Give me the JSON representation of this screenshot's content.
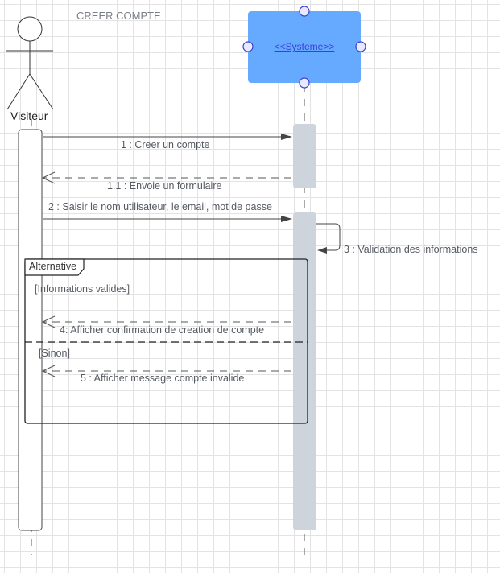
{
  "diagram": {
    "title": "CREER COMPTE",
    "actor": {
      "name": "Visiteur"
    },
    "system": {
      "name": "<<Systeme>>"
    },
    "messages": [
      {
        "id": "m1",
        "label": "1 : Creer un compte",
        "type": "sync"
      },
      {
        "id": "m11",
        "label": "1.1 : Envoie un formulaire",
        "type": "return"
      },
      {
        "id": "m2",
        "label": "2 : Saisir  le nom utilisateur, le email, mot de passe",
        "type": "sync"
      },
      {
        "id": "m3",
        "label": "3 : Validation des informations",
        "type": "self"
      },
      {
        "id": "m4",
        "label": "4: Afficher confirmation de creation de compte",
        "type": "return"
      },
      {
        "id": "m5",
        "label": "5 : Afficher message compte invalide",
        "type": "return"
      }
    ],
    "fragment": {
      "operator": "Alternative",
      "guards": [
        "[Informations valides]",
        "[Sinon]"
      ]
    }
  }
}
